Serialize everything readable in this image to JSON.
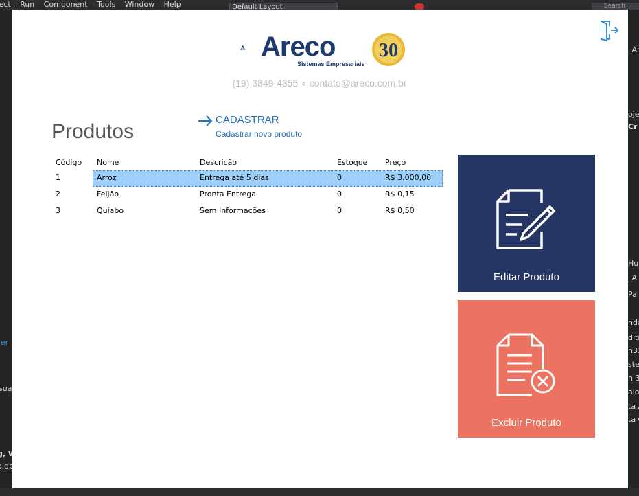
{
  "ide": {
    "menu": [
      "Project",
      "Run",
      "Component",
      "Tools",
      "Window",
      "Help"
    ],
    "layout_combo": "Default Layout",
    "search_placeholder": "Search",
    "left_fragments": [
      "ner",
      "sual",
      "g, W",
      "o.dp"
    ],
    "right_fragments": [
      "_Ar",
      "oje",
      "Cr",
      "Hul",
      "_A",
      "Pal",
      "nda",
      "diti",
      "n32",
      "ster",
      "n 3",
      "alog",
      "ta A",
      "ta C"
    ]
  },
  "header": {
    "logo_name": "Areco",
    "logo_tagline": "Sistemas Empresariais",
    "logo_badge": "30",
    "contact": "(19) 3849-4355 ∘ contato@areco.com.br"
  },
  "page": {
    "title": "Produtos"
  },
  "cadastrar": {
    "label": "CADASTRAR",
    "sublabel": "Cadastrar novo produto"
  },
  "grid": {
    "columns": [
      "Código",
      "Nome",
      "Descrição",
      "Estoque",
      "Preço"
    ],
    "rows": [
      [
        "1",
        "Arroz",
        "Entrega até 5 dias",
        "0",
        "R$ 3.000,00"
      ],
      [
        "2",
        "Feijão",
        "Pronta Entrega",
        "0",
        "R$ 0,15"
      ],
      [
        "3",
        "Quiabo",
        "Sem Informações",
        "0",
        "R$ 0,50"
      ]
    ],
    "selected_row": 0
  },
  "tiles": {
    "edit_label": "Editar Produto",
    "delete_label": "Excluir Produto"
  },
  "colors": {
    "brand_navy": "#253564",
    "delete_coral": "#ec7361",
    "link_blue": "#1e6fc0",
    "selection": "#9fd0fb"
  }
}
